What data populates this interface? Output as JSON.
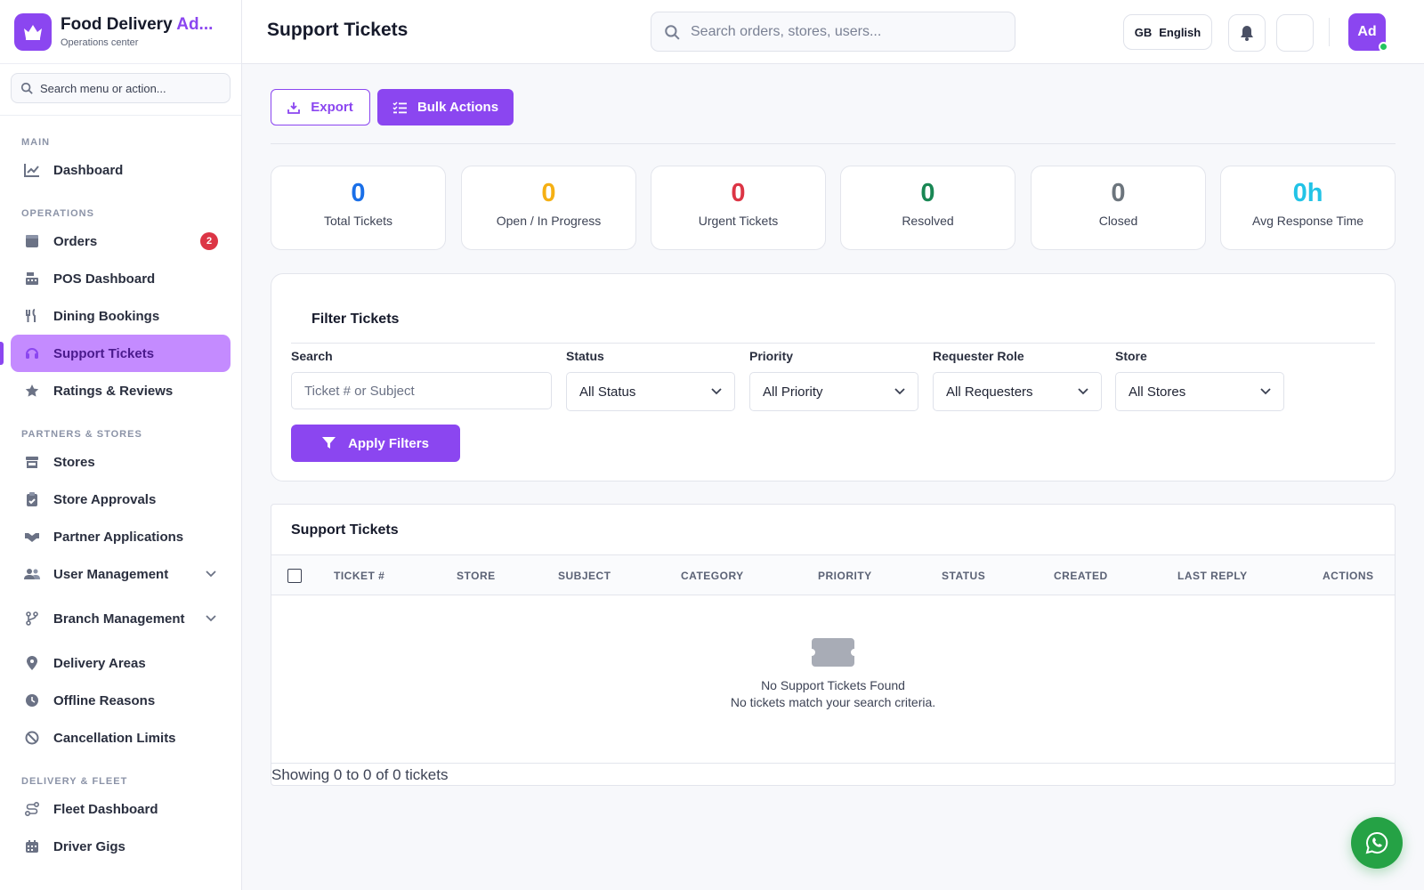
{
  "brand": {
    "title_main": "Food Delivery ",
    "title_accent": "Ad...",
    "subtitle": "Operations center"
  },
  "sidebar": {
    "search_placeholder": "Search menu or action...",
    "sections": {
      "main": "MAIN",
      "operations": "OPERATIONS",
      "partners": "PARTNERS & STORES",
      "fleet": "DELIVERY & FLEET"
    },
    "items": {
      "dashboard": "Dashboard",
      "orders": "Orders",
      "orders_badge": "2",
      "pos": "POS Dashboard",
      "dining": "Dining Bookings",
      "support": "Support Tickets",
      "ratings": "Ratings & Reviews",
      "stores": "Stores",
      "store_approvals": "Store Approvals",
      "partner_apps": "Partner Applications",
      "user_mgmt": "User Management",
      "branch_mgmt": "Branch Management",
      "delivery_areas": "Delivery Areas",
      "offline_reasons": "Offline Reasons",
      "cancellation": "Cancellation Limits",
      "fleet_dashboard": "Fleet Dashboard",
      "driver_gigs": "Driver Gigs"
    }
  },
  "header": {
    "title": "Support Tickets",
    "search_placeholder": "Search orders, stores, users...",
    "lang_code": "GB",
    "lang_label": "English",
    "avatar_initials": "Ad"
  },
  "actions": {
    "export": "Export",
    "bulk": "Bulk Actions"
  },
  "stats": [
    {
      "value": "0",
      "label": "Total Tickets",
      "color": "#1a6fe8"
    },
    {
      "value": "0",
      "label": "Open / In Progress",
      "color": "#f5b014"
    },
    {
      "value": "0",
      "label": "Urgent Tickets",
      "color": "#dc3545"
    },
    {
      "value": "0",
      "label": "Resolved",
      "color": "#198754"
    },
    {
      "value": "0",
      "label": "Closed",
      "color": "#6c757d"
    },
    {
      "value": "0h",
      "label": "Avg Response Time",
      "color": "#22c3e6"
    }
  ],
  "filters": {
    "title": "Filter Tickets",
    "search_label": "Search",
    "search_placeholder": "Ticket # or Subject",
    "status_label": "Status",
    "status_value": "All Status",
    "priority_label": "Priority",
    "priority_value": "All Priority",
    "role_label": "Requester Role",
    "role_value": "All Requesters",
    "store_label": "Store",
    "store_value": "All Stores",
    "apply": "Apply Filters"
  },
  "table": {
    "title": "Support Tickets",
    "columns": [
      "TICKET #",
      "STORE",
      "SUBJECT",
      "CATEGORY",
      "PRIORITY",
      "STATUS",
      "CREATED",
      "LAST REPLY",
      "ACTIONS"
    ],
    "empty_title": "No Support Tickets Found",
    "empty_sub": "No tickets match your search criteria.",
    "showing": "Showing 0 to 0 of 0 tickets"
  },
  "colors": {
    "accent": "#8b46f0",
    "active_bg": "#c48bff",
    "whatsapp": "#25a245"
  }
}
